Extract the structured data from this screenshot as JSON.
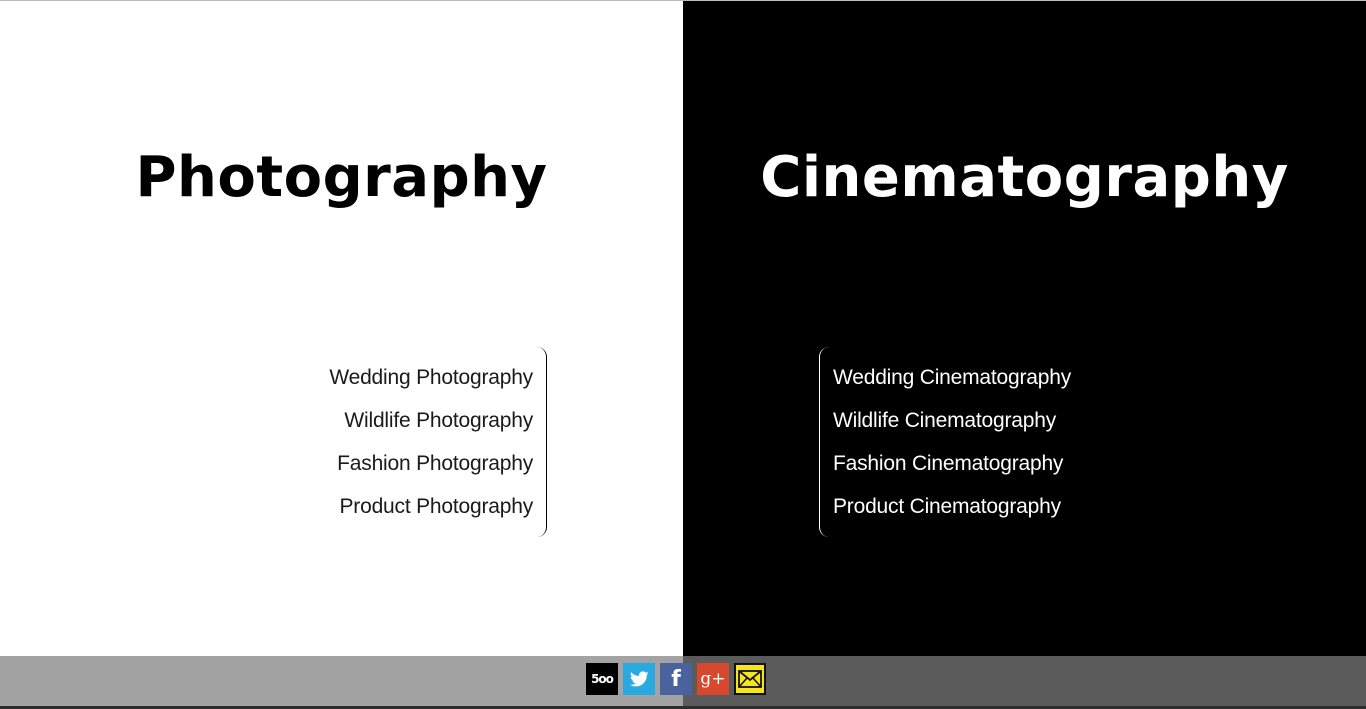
{
  "left_panel": {
    "heading": "Photography",
    "items": [
      {
        "label": "Wedding Photography"
      },
      {
        "label": "Wildlife Photography"
      },
      {
        "label": "Fashion Photography"
      },
      {
        "label": "Product Photography"
      }
    ]
  },
  "right_panel": {
    "heading": "Cinematography",
    "items": [
      {
        "label": "Wedding Cinematography"
      },
      {
        "label": "Wildlife Cinematography"
      },
      {
        "label": "Fashion Cinematography"
      },
      {
        "label": "Product Cinematography"
      }
    ]
  },
  "footer": {
    "social": [
      {
        "icon": "500px-icon",
        "text": "5oo",
        "color": "#000000"
      },
      {
        "icon": "twitter-icon",
        "color": "#2aa9e0"
      },
      {
        "icon": "facebook-icon",
        "text": "f",
        "color": "#4a639e"
      },
      {
        "icon": "google-plus-icon",
        "text": "g+",
        "color": "#d6492f"
      },
      {
        "icon": "email-icon",
        "color": "#f6e51b"
      }
    ]
  },
  "colors": {
    "left_background": "#ffffff",
    "right_background": "#000000",
    "footer_left": "#a3a3a3",
    "footer_right": "#5b5b5b"
  }
}
